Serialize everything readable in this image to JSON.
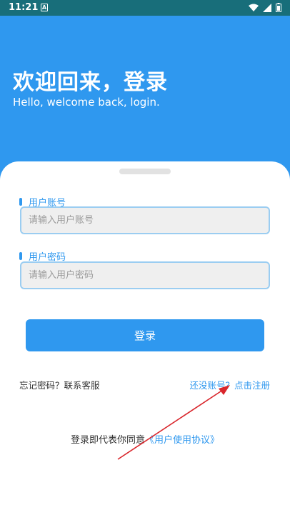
{
  "status_bar": {
    "time": "11:21",
    "notification_letter": "A",
    "icons": [
      "wifi-icon",
      "signal-icon",
      "battery-icon"
    ]
  },
  "header": {
    "title": "欢迎回来，登录",
    "subtitle": "Hello, welcome back, login."
  },
  "form": {
    "account_label": "用户账号",
    "account_placeholder": "请输入用户账号",
    "account_value": "",
    "password_label": "用户密码",
    "password_placeholder": "请输入用户密码",
    "password_value": "",
    "login_button": "登录"
  },
  "links": {
    "forgot": "忘记密码？联系客服",
    "register": "还没账号？点击注册"
  },
  "agreement": {
    "prefix": "登录即代表你同意",
    "link": "《用户使用协议》"
  },
  "colors": {
    "primary": "#2f98ef",
    "status_bar": "#186e7a",
    "annotation_arrow": "#d9262c"
  }
}
